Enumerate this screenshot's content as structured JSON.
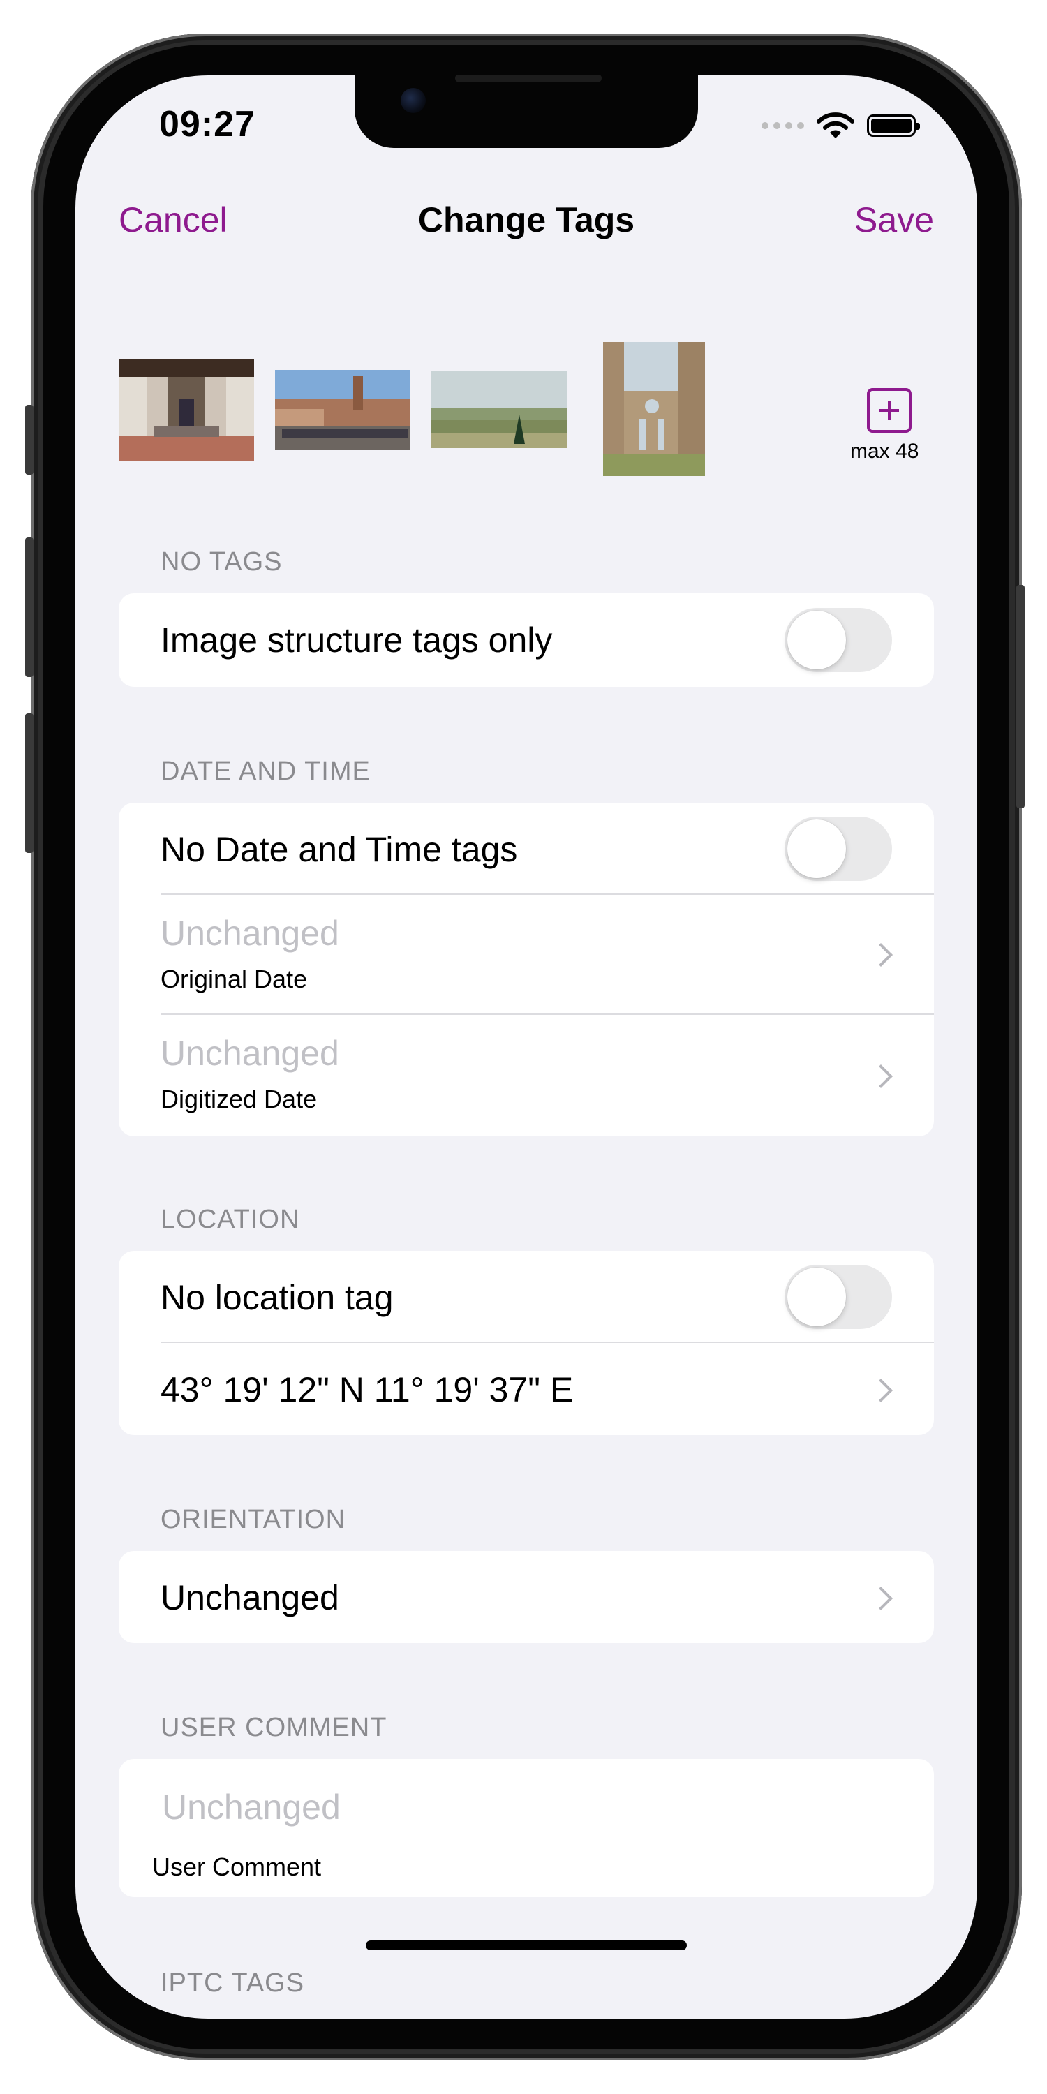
{
  "status_bar": {
    "time": "09:27"
  },
  "nav": {
    "cancel_label": "Cancel",
    "title": "Change Tags",
    "save_label": "Save"
  },
  "images": {
    "max_label": "max 48",
    "thumbnails": [
      "church-interior",
      "town-square",
      "countryside",
      "abbey-ruins"
    ]
  },
  "sections": {
    "no_tags": {
      "header": "NO TAGS",
      "toggle_label": "Image structure tags only",
      "toggle_on": false
    },
    "date_time": {
      "header": "DATE AND TIME",
      "toggle_label": "No Date and Time tags",
      "toggle_on": false,
      "original_date_value": "Unchanged",
      "original_date_label": "Original Date",
      "digitized_date_value": "Unchanged",
      "digitized_date_label": "Digitized Date"
    },
    "location": {
      "header": "LOCATION",
      "toggle_label": "No location tag",
      "toggle_on": false,
      "coordinates": "43° 19' 12\" N 11° 19' 37\" E"
    },
    "orientation": {
      "header": "ORIENTATION",
      "value": "Unchanged"
    },
    "user_comment": {
      "header": "USER COMMENT",
      "placeholder": "Unchanged",
      "label": "User Comment"
    },
    "iptc": {
      "header": "IPTC TAGS"
    }
  },
  "colors": {
    "accent": "#8e1a8e",
    "background": "#f2f2f7",
    "secondary_text": "#8a8a8e",
    "placeholder_text": "#c0c0c5"
  }
}
